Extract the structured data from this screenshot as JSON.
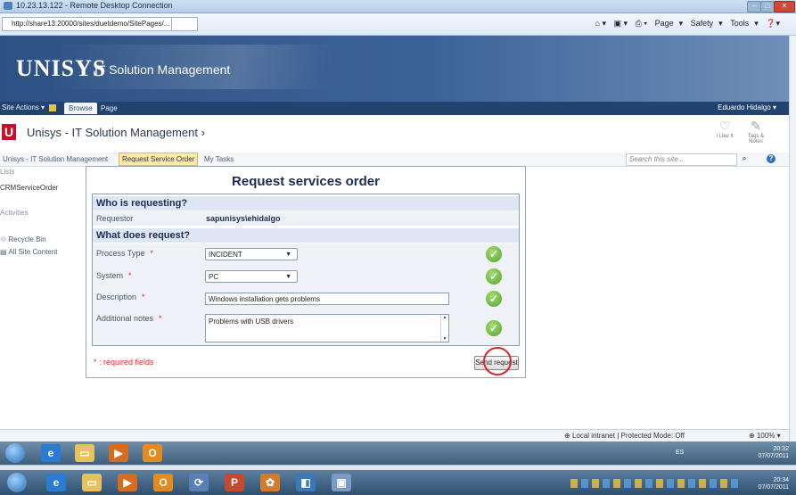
{
  "window": {
    "title": "10.23.13.122 - Remote Desktop Connection"
  },
  "browser": {
    "address": "http://share13:20000/sites/duetdemo/SitePages/...",
    "tools": [
      "Page",
      "Safety",
      "Tools"
    ]
  },
  "banner": {
    "logo": "UNISYS",
    "app_title": "IT Solution Management"
  },
  "ribbon": {
    "site_actions": "Site Actions",
    "tabs": [
      "Browse",
      "Page"
    ],
    "user": "Eduardo Hidalgo"
  },
  "header": {
    "logo_letter": "U",
    "site_title": "Unisys - IT Solution Management",
    "separator": "›",
    "social": [
      "I Like It",
      "Tags & Notes"
    ]
  },
  "topnav": {
    "items": [
      "Unisys - IT Solution Management",
      "Request Service Order",
      "My Tasks"
    ],
    "search_placeholder": "Search this site..."
  },
  "leftnav": {
    "items": [
      "Lists",
      "CRMServiceOrder",
      "Activities",
      "Recycle Bin",
      "All Site Content"
    ]
  },
  "form": {
    "title": "Request services order",
    "section_who": "Who is requesting?",
    "requestor_label": "Requestor",
    "requestor_value": "sapunisys\\ehidalgo",
    "section_what": "What does request?",
    "required_mark": "*",
    "process_type_label": "Process Type",
    "process_type_value": "INCIDENT",
    "system_label": "System",
    "system_value": "PC",
    "description_label": "Description",
    "description_value": "Windows installation gets problems",
    "notes_label": "Additional notes",
    "notes_value": "Problems with USB drivers",
    "required_note": "* : required fields",
    "send_label": "Send request"
  },
  "status": {
    "zone": "Local intranet | Protected Mode: Off",
    "zoom": "100%"
  },
  "taskbar": {
    "inner_lang": "ES",
    "inner_time": "20:32",
    "inner_date": "07/07/2011",
    "outer_time": "20:34",
    "outer_date": "07/07/2011"
  },
  "colors": {
    "banner": "#3c6399",
    "ribbon": "#21436f",
    "section": "#dde6f2",
    "required": "#d62a2a",
    "ok": "#52a02a"
  }
}
